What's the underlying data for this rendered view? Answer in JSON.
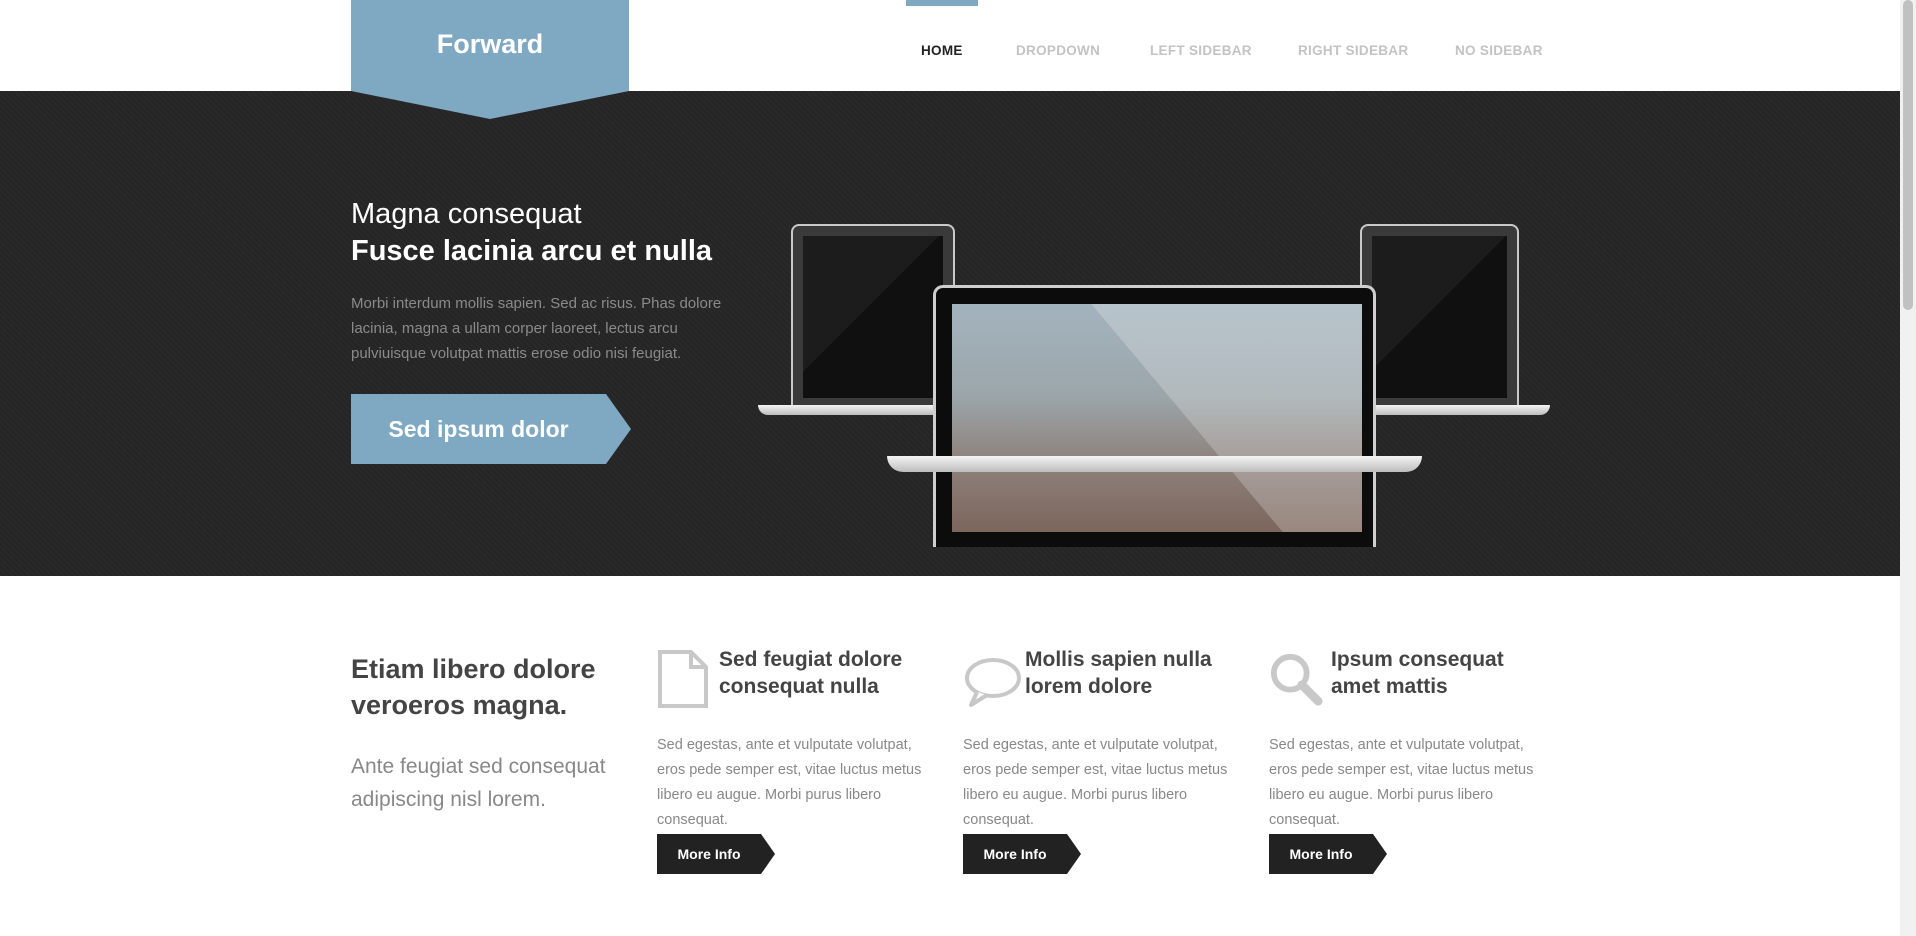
{
  "header": {
    "logo": "Forward",
    "nav": [
      {
        "label": "Home",
        "active": true
      },
      {
        "label": "Dropdown",
        "active": false
      },
      {
        "label": "Left Sidebar",
        "active": false
      },
      {
        "label": "Right Sidebar",
        "active": false
      },
      {
        "label": "No Sidebar",
        "active": false
      }
    ]
  },
  "hero": {
    "subtitle": "Magna consequat",
    "title": "Fusce lacinia arcu et nulla",
    "text": "Morbi interdum mollis sapien. Sed ac risus. Phas dolore lacinia, magna a ullam corper laoreet, lectus arcu pulviuisque volutpat mattis erose odio nisi feugiat.",
    "button": "Sed ipsum dolor"
  },
  "intro": {
    "title": "Etiam libero dolore veroeros magna.",
    "text": "Ante feugiat sed consequat adipiscing nisl lorem."
  },
  "features": [
    {
      "icon": "document-icon",
      "title": "Sed feugiat dolore consequat nulla",
      "text": "Sed egestas, ante et vulputate volutpat, eros pede semper est, vitae luctus metus libero eu augue. Morbi purus libero consequat.",
      "button": "More Info"
    },
    {
      "icon": "speech-bubble-icon",
      "title": "Mollis sapien nulla lorem dolore",
      "text": "Sed egestas, ante et vulputate volutpat, eros pede semper est, vitae luctus metus libero eu augue. Morbi purus libero consequat.",
      "button": "More Info"
    },
    {
      "icon": "magnifier-icon",
      "title": "Ipsum consequat amet mattis",
      "text": "Sed egestas, ante et vulputate volutpat, eros pede semper est, vitae luctus metus libero eu augue. Morbi purus libero consequat.",
      "button": "More Info"
    }
  ],
  "colors": {
    "accent": "#7fa8c3",
    "hero_bg": "#262626",
    "dark_button": "#222222"
  }
}
